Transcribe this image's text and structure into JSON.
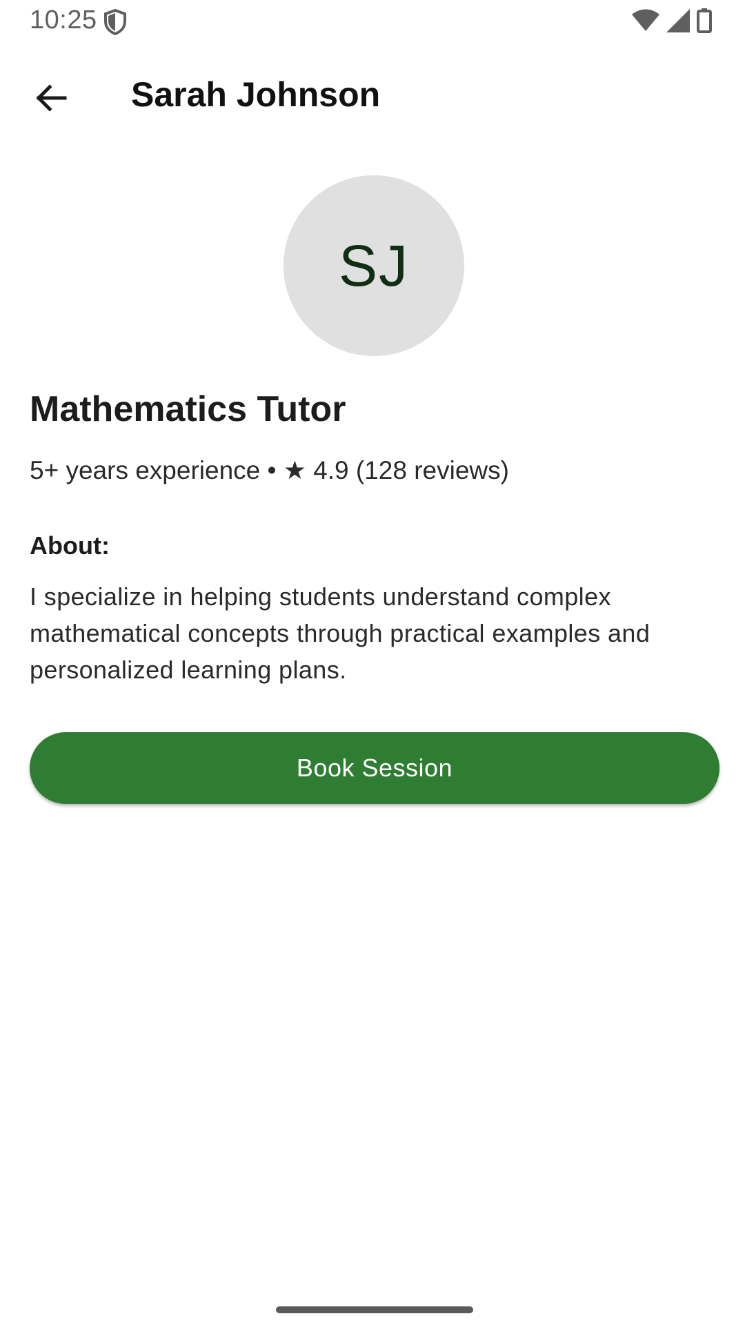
{
  "status_bar": {
    "time": "10:25",
    "icons": [
      "shield-icon",
      "wifi-icon",
      "signal-icon",
      "battery-icon"
    ]
  },
  "app_bar": {
    "back_icon": "arrow-left-icon",
    "title": "Sarah Johnson"
  },
  "profile": {
    "initials": "SJ",
    "role": "Mathematics Tutor",
    "meta": "5+ years experience • ★ 4.9 (128 reviews)",
    "about_label": "About:",
    "about_text": "I specialize in helping students understand complex mathematical concepts through practical examples and personalized learning plans."
  },
  "actions": {
    "book_label": "Book Session"
  },
  "colors": {
    "primary": "#2e7d32",
    "avatar_bg": "#e0e0e0",
    "avatar_text": "#0f2e14",
    "background": "#ffffff"
  }
}
